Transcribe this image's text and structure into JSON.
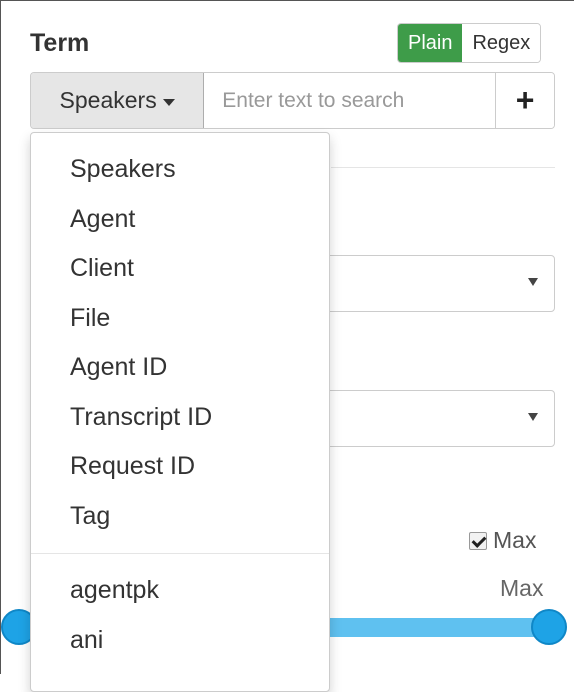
{
  "header": {
    "title": "Term",
    "mode_plain": "Plain",
    "mode_regex": "Regex"
  },
  "search": {
    "field_selected": "Speakers",
    "placeholder": "Enter text to search",
    "add_label": "+"
  },
  "dropdown": {
    "items": [
      "Speakers",
      "Agent",
      "Client",
      "File",
      "Agent ID",
      "Transcript ID",
      "Request ID",
      "Tag"
    ],
    "extra_items": [
      "agentpk",
      "ani"
    ]
  },
  "range": {
    "max_checkbox_label": "Max",
    "max_checked": true,
    "max_label": "Max",
    "min_fraction": 0.0,
    "max_fraction": 1.0
  },
  "colors": {
    "active_mode": "#3e9c49",
    "slider_track": "#5fc1f0",
    "slider_handle": "#1ea3e6"
  }
}
